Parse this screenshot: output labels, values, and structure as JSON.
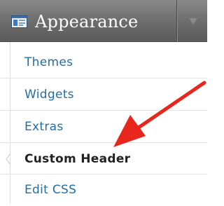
{
  "menu": {
    "title": "Appearance",
    "icon": "appearance-icon",
    "toggle_icon": "chevron-down-icon",
    "items": [
      {
        "label": "Themes",
        "current": false
      },
      {
        "label": "Widgets",
        "current": false
      },
      {
        "label": "Extras",
        "current": false
      },
      {
        "label": "Custom Header",
        "current": true
      },
      {
        "label": "Edit CSS",
        "current": false
      }
    ]
  },
  "colors": {
    "header_bg": "#6e6e6e",
    "link": "#1f6fa6",
    "current_text": "#222222",
    "annotation_arrow": "#e8261c"
  },
  "annotation": {
    "type": "arrow",
    "points_to": "Custom Header"
  }
}
